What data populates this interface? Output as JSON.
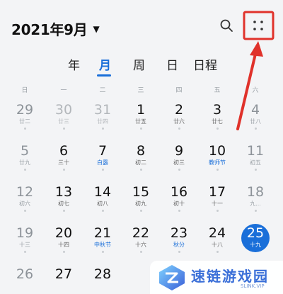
{
  "header": {
    "title": "2021年9月",
    "caret_icon": "triangle-down-icon",
    "search_icon": "search-icon",
    "more_icon": "four-dots-icon"
  },
  "tabs": [
    {
      "label": "年",
      "active": false
    },
    {
      "label": "月",
      "active": true
    },
    {
      "label": "周",
      "active": false
    },
    {
      "label": "日",
      "active": false
    },
    {
      "label": "日程",
      "active": false
    }
  ],
  "weekdays": [
    "日",
    "一",
    "二",
    "三",
    "四",
    "五",
    "六"
  ],
  "weeks": [
    [
      {
        "day": "29",
        "sub": "廿二",
        "dim": true
      },
      {
        "day": "30",
        "sub": "廿三",
        "dim": true
      },
      {
        "day": "31",
        "sub": "廿四",
        "dim": true
      },
      {
        "day": "1",
        "sub": "廿五"
      },
      {
        "day": "2",
        "sub": "廿六"
      },
      {
        "day": "3",
        "sub": "廿七"
      },
      {
        "day": "4",
        "sub": "廿八"
      }
    ],
    [
      {
        "day": "5",
        "sub": "廿九"
      },
      {
        "day": "6",
        "sub": "三十"
      },
      {
        "day": "7",
        "sub": "白露",
        "festival": true
      },
      {
        "day": "8",
        "sub": "初二"
      },
      {
        "day": "9",
        "sub": "初三"
      },
      {
        "day": "10",
        "sub": "教师节",
        "festival": true
      },
      {
        "day": "11",
        "sub": "初五"
      }
    ],
    [
      {
        "day": "12",
        "sub": "初六"
      },
      {
        "day": "13",
        "sub": "初七"
      },
      {
        "day": "14",
        "sub": "初八"
      },
      {
        "day": "15",
        "sub": "初九"
      },
      {
        "day": "16",
        "sub": "初十"
      },
      {
        "day": "17",
        "sub": "十一"
      },
      {
        "day": "18",
        "sub": "九..."
      }
    ],
    [
      {
        "day": "19",
        "sub": "十三"
      },
      {
        "day": "20",
        "sub": "十四"
      },
      {
        "day": "21",
        "sub": "中秋节",
        "festival": true
      },
      {
        "day": "22",
        "sub": "十六"
      },
      {
        "day": "23",
        "sub": "秋分",
        "festival": true
      },
      {
        "day": "24",
        "sub": "十八"
      },
      {
        "day": "25",
        "sub": "十九",
        "today": true
      }
    ],
    [
      {
        "day": "26",
        "sub": ""
      },
      {
        "day": "27",
        "sub": ""
      },
      {
        "day": "28",
        "sub": ""
      },
      {
        "day": "",
        "sub": ""
      },
      {
        "day": "",
        "sub": ""
      },
      {
        "day": "",
        "sub": ""
      },
      {
        "day": "",
        "sub": ""
      }
    ]
  ],
  "watermark": {
    "text": "速链游戏园",
    "sub": "SLINK.VIP"
  },
  "colors": {
    "accent": "#1a6fd9",
    "annotation": "#e0322b"
  }
}
